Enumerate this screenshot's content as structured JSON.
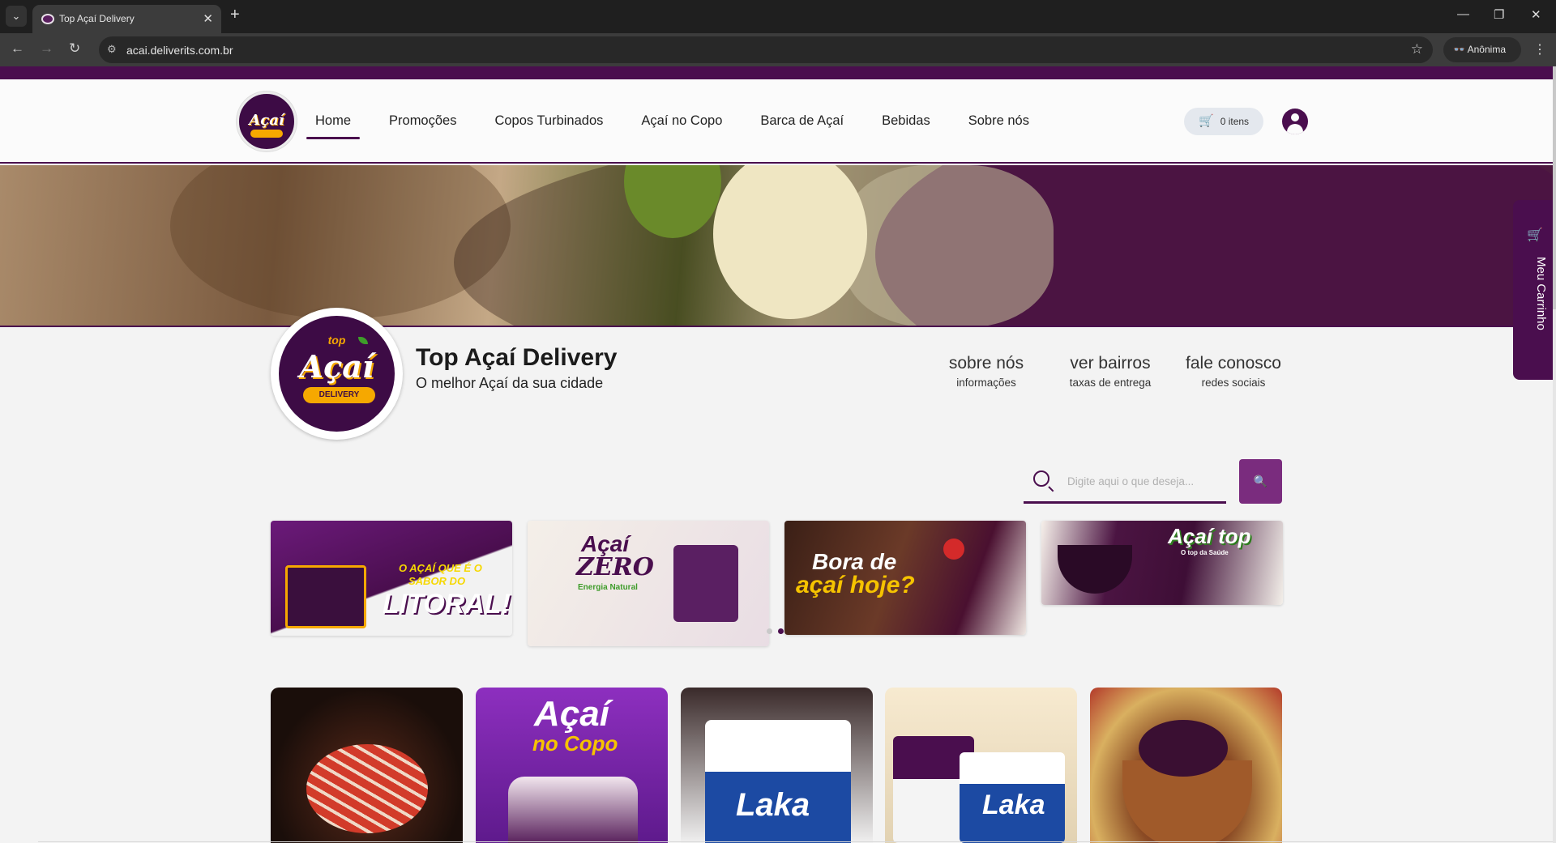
{
  "browser": {
    "tab_title": "Top Açaí Delivery",
    "url": "acai.deliverits.com.br",
    "profile_label": "Anônima"
  },
  "header": {
    "nav_items": [
      "Home",
      "Promoções",
      "Copos Turbinados",
      "Açaí no Copo",
      "Barca de Açaí",
      "Bebidas",
      "Sobre nós"
    ],
    "active_nav": "Home",
    "cart_label": "0 itens"
  },
  "side_cart": {
    "label": "Meu Carrinho"
  },
  "store": {
    "name": "Top Açaí Delivery",
    "tagline": "O melhor Açaí da sua cidade",
    "logo_text": {
      "top": "top",
      "word": "Açaí",
      "ribbon": "DELIVERY"
    }
  },
  "info_links": [
    {
      "title": "sobre nós",
      "subtitle": "informações"
    },
    {
      "title": "ver bairros",
      "subtitle": "taxas de entrega"
    },
    {
      "title": "fale conosco",
      "subtitle": "redes sociais"
    }
  ],
  "search": {
    "placeholder": "Digite aqui o que deseja..."
  },
  "promos": [
    {
      "text_line1": "O AÇAÍ QUE É O",
      "text_line2": "SABOR DO",
      "text_line3": "LITORAL!"
    },
    {
      "text_line1": "Açaí",
      "text_line2": "ZERO",
      "text_line3": "Energia Natural"
    },
    {
      "text_line1": "Bora de",
      "text_line2": "açaí hoje?"
    },
    {
      "text_line1": "Açaí top",
      "text_line2": "O top da Saúde"
    }
  ],
  "categories": [
    {
      "name": "barca"
    },
    {
      "name": "acai-no-copo",
      "text_line1": "Açaí",
      "text_line2": "no Copo"
    },
    {
      "name": "oreo-copo",
      "text": "Laka"
    },
    {
      "name": "copos-duplos",
      "text": "Laka"
    },
    {
      "name": "acai-tigela"
    }
  ],
  "colors": {
    "brand_purple": "#4a0e4e",
    "button_purple": "#7a2c7e",
    "accent_yellow": "#f6a800"
  }
}
